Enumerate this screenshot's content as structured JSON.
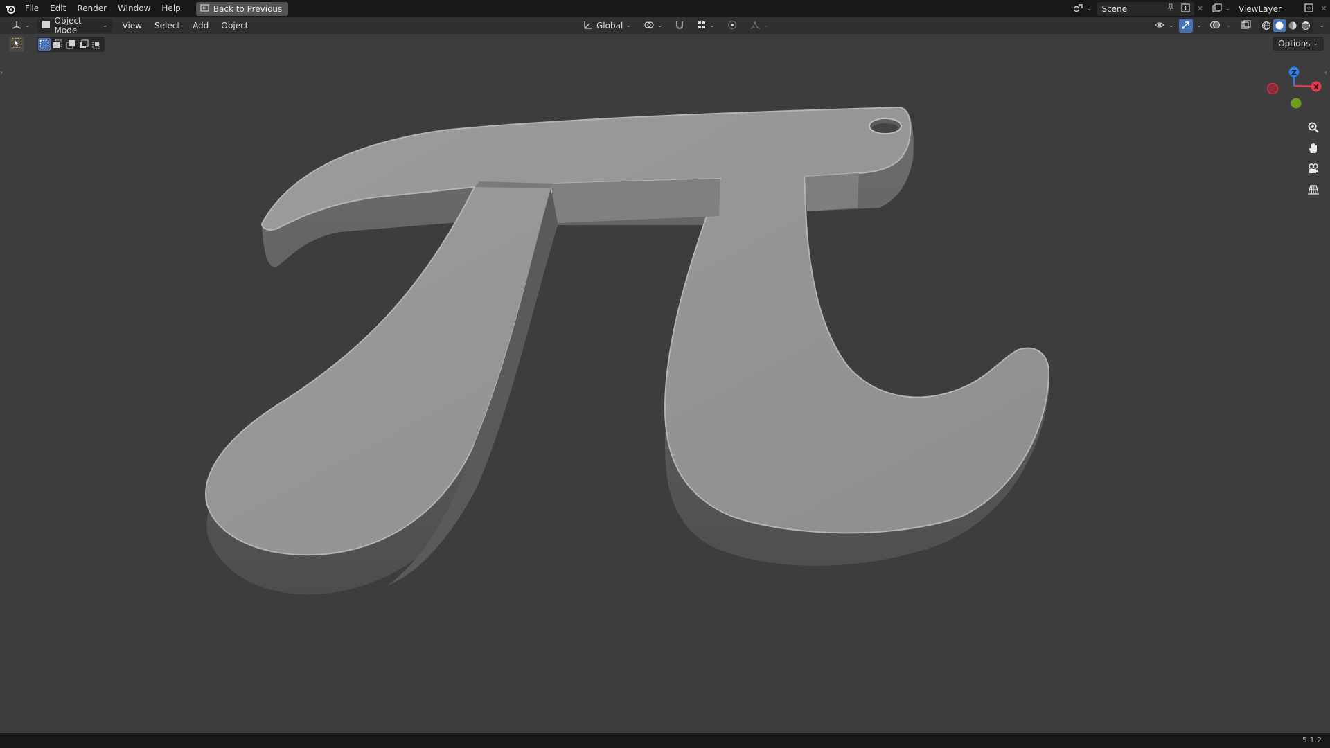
{
  "topbar": {
    "menus": [
      "File",
      "Edit",
      "Render",
      "Window",
      "Help"
    ],
    "back_label": "Back to Previous",
    "scene_label": "Scene",
    "viewlayer_label": "ViewLayer"
  },
  "header": {
    "mode_label": "Object Mode",
    "menus": [
      "View",
      "Select",
      "Add",
      "Object"
    ],
    "orientation_label": "Global"
  },
  "toolbar": {
    "options_label": "Options"
  },
  "status": {
    "version": "5.1.2"
  },
  "colors": {
    "topbar_bg": "#181818",
    "header_bg": "#303030",
    "viewport_bg": "#3d3d3d",
    "accent": "#4772b3",
    "axis_x": "#e23b53",
    "axis_y": "#6e9e1c",
    "axis_z": "#2f80e0"
  }
}
